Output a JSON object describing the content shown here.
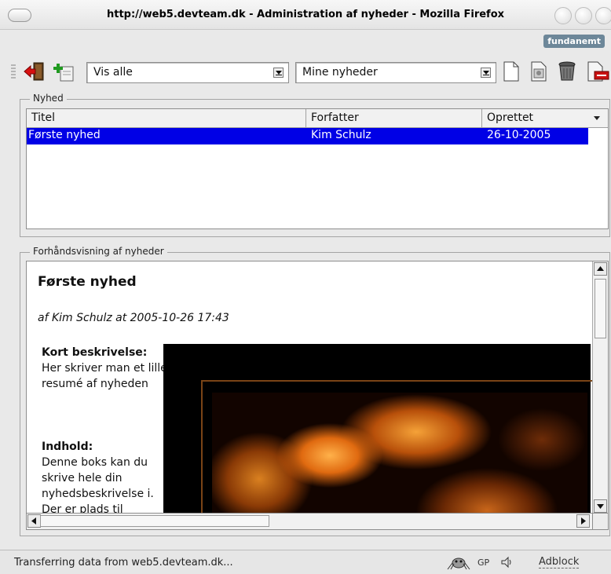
{
  "window": {
    "title": "http://web5.devteam.dk - Administration af nyheder - Mozilla Firefox",
    "brand": "fundanemt"
  },
  "toolbar": {
    "filter_select": "Vis alle",
    "news_select": "Mine nyheder",
    "icons": [
      "logout-icon",
      "add-icon",
      "new-document-icon",
      "edit-icon",
      "trash-icon",
      "delete-icon"
    ]
  },
  "news_list": {
    "legend": "Nyhed",
    "columns": [
      "Titel",
      "Forfatter",
      "Oprettet"
    ],
    "rows": [
      {
        "title": "Første nyhed",
        "author": "Kim Schulz",
        "created": "26-10-2005"
      }
    ]
  },
  "preview": {
    "legend": "Forhåndsvisning af nyheder",
    "title": "Første nyhed",
    "byline": "af Kim Schulz at 2005-10-26 17:43",
    "short_label": "Kort beskrivelse:",
    "short_text": "Her skriver man et lille resumé af nyheden",
    "content_label": "Indhold:",
    "content_text": "Denne boks kan du skrive hele din nyhedsbeskrivelse i. Der er plads til"
  },
  "statusbar": {
    "text": "Transferring data from web5.devteam.dk...",
    "gp": "GP",
    "adblock": "Adblock"
  },
  "colors": {
    "selection": "#0000e6",
    "brand_bg": "#6d8799"
  }
}
